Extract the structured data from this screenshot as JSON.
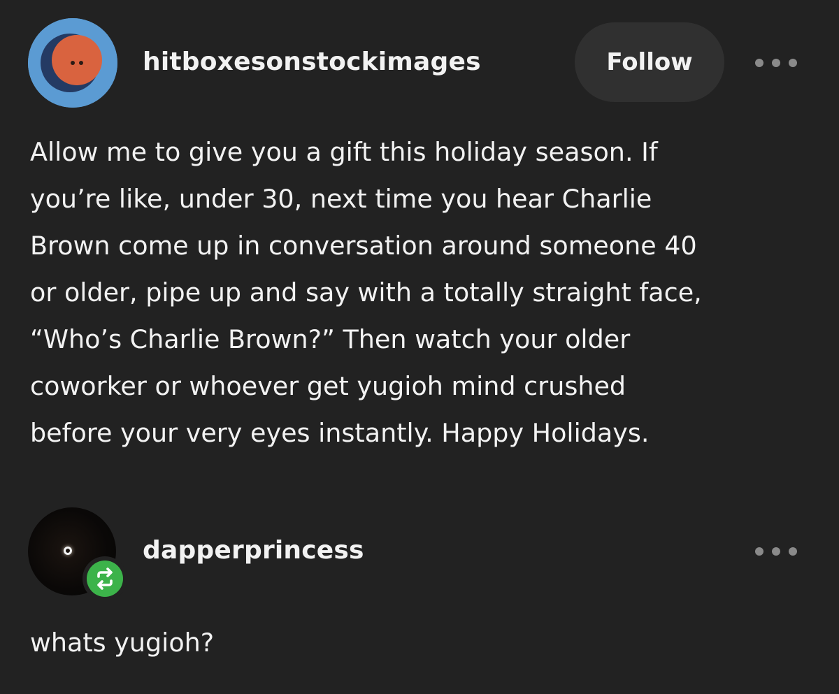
{
  "post": {
    "author": "hitboxesonstockimages",
    "follow_label": "Follow",
    "body_lines": [
      "Allow me to give you a gift this holiday season. If",
      "you’re like, under 30, next time you hear Charlie",
      "Brown come up in conversation around someone 40",
      "or older, pipe up and say with a totally straight face,",
      "“Who’s Charlie Brown?” Then watch your older",
      "coworker or whoever get yugioh mind crushed",
      "before your very eyes instantly. Happy Holidays."
    ]
  },
  "reblog": {
    "author": "dapperprincess",
    "text": "whats yugioh?"
  },
  "icons": {
    "avatar1": "orange-face-avatar-icon",
    "more": "ellipsis-icon",
    "reblog": "reblog-icon"
  },
  "colors": {
    "background": "#222222",
    "follow_button": "#303030",
    "avatar1_bg": "#5b9bd3",
    "avatar1_face": "#d9633f",
    "reblog_badge": "#3cb34a"
  }
}
